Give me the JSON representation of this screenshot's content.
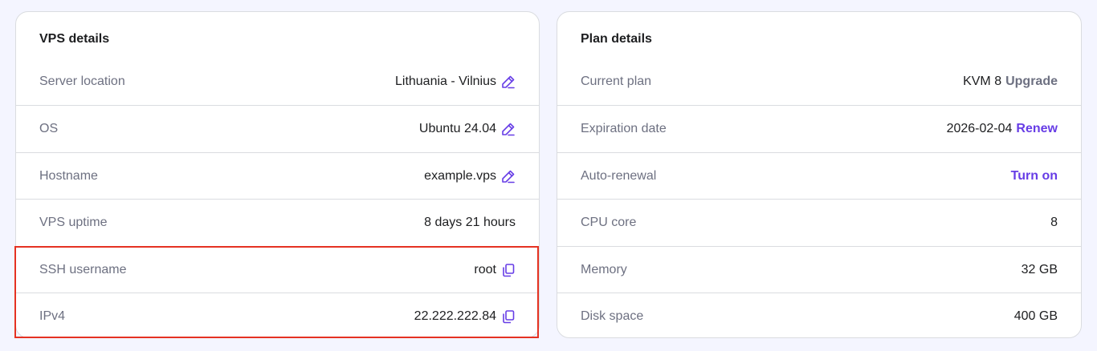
{
  "vps": {
    "title": "VPS details",
    "rows": [
      {
        "label": "Server location",
        "value": "Lithuania - Vilnius",
        "icon": "edit-icon"
      },
      {
        "label": "OS",
        "value": "Ubuntu 24.04",
        "icon": "edit-icon"
      },
      {
        "label": "Hostname",
        "value": "example.vps",
        "icon": "edit-icon"
      },
      {
        "label": "VPS uptime",
        "value": "8 days 21 hours"
      },
      {
        "label": "SSH username",
        "value": "root",
        "icon": "copy-icon"
      },
      {
        "label": "IPv4",
        "value": "22.222.222.84",
        "icon": "copy-icon"
      }
    ]
  },
  "plan": {
    "title": "Plan details",
    "rows": [
      {
        "label": "Current plan",
        "value": "KVM 8",
        "action": "Upgrade"
      },
      {
        "label": "Expiration date",
        "value": "2026-02-04",
        "action": "Renew"
      },
      {
        "label": "Auto-renewal",
        "action": "Turn on"
      },
      {
        "label": "CPU core",
        "value": "8"
      },
      {
        "label": "Memory",
        "value": "32 GB"
      },
      {
        "label": "Disk space",
        "value": "400 GB"
      }
    ]
  },
  "colors": {
    "accent": "#673de6",
    "highlight": "#e53222",
    "muted": "#6d7081",
    "background": "#f4f5ff"
  }
}
